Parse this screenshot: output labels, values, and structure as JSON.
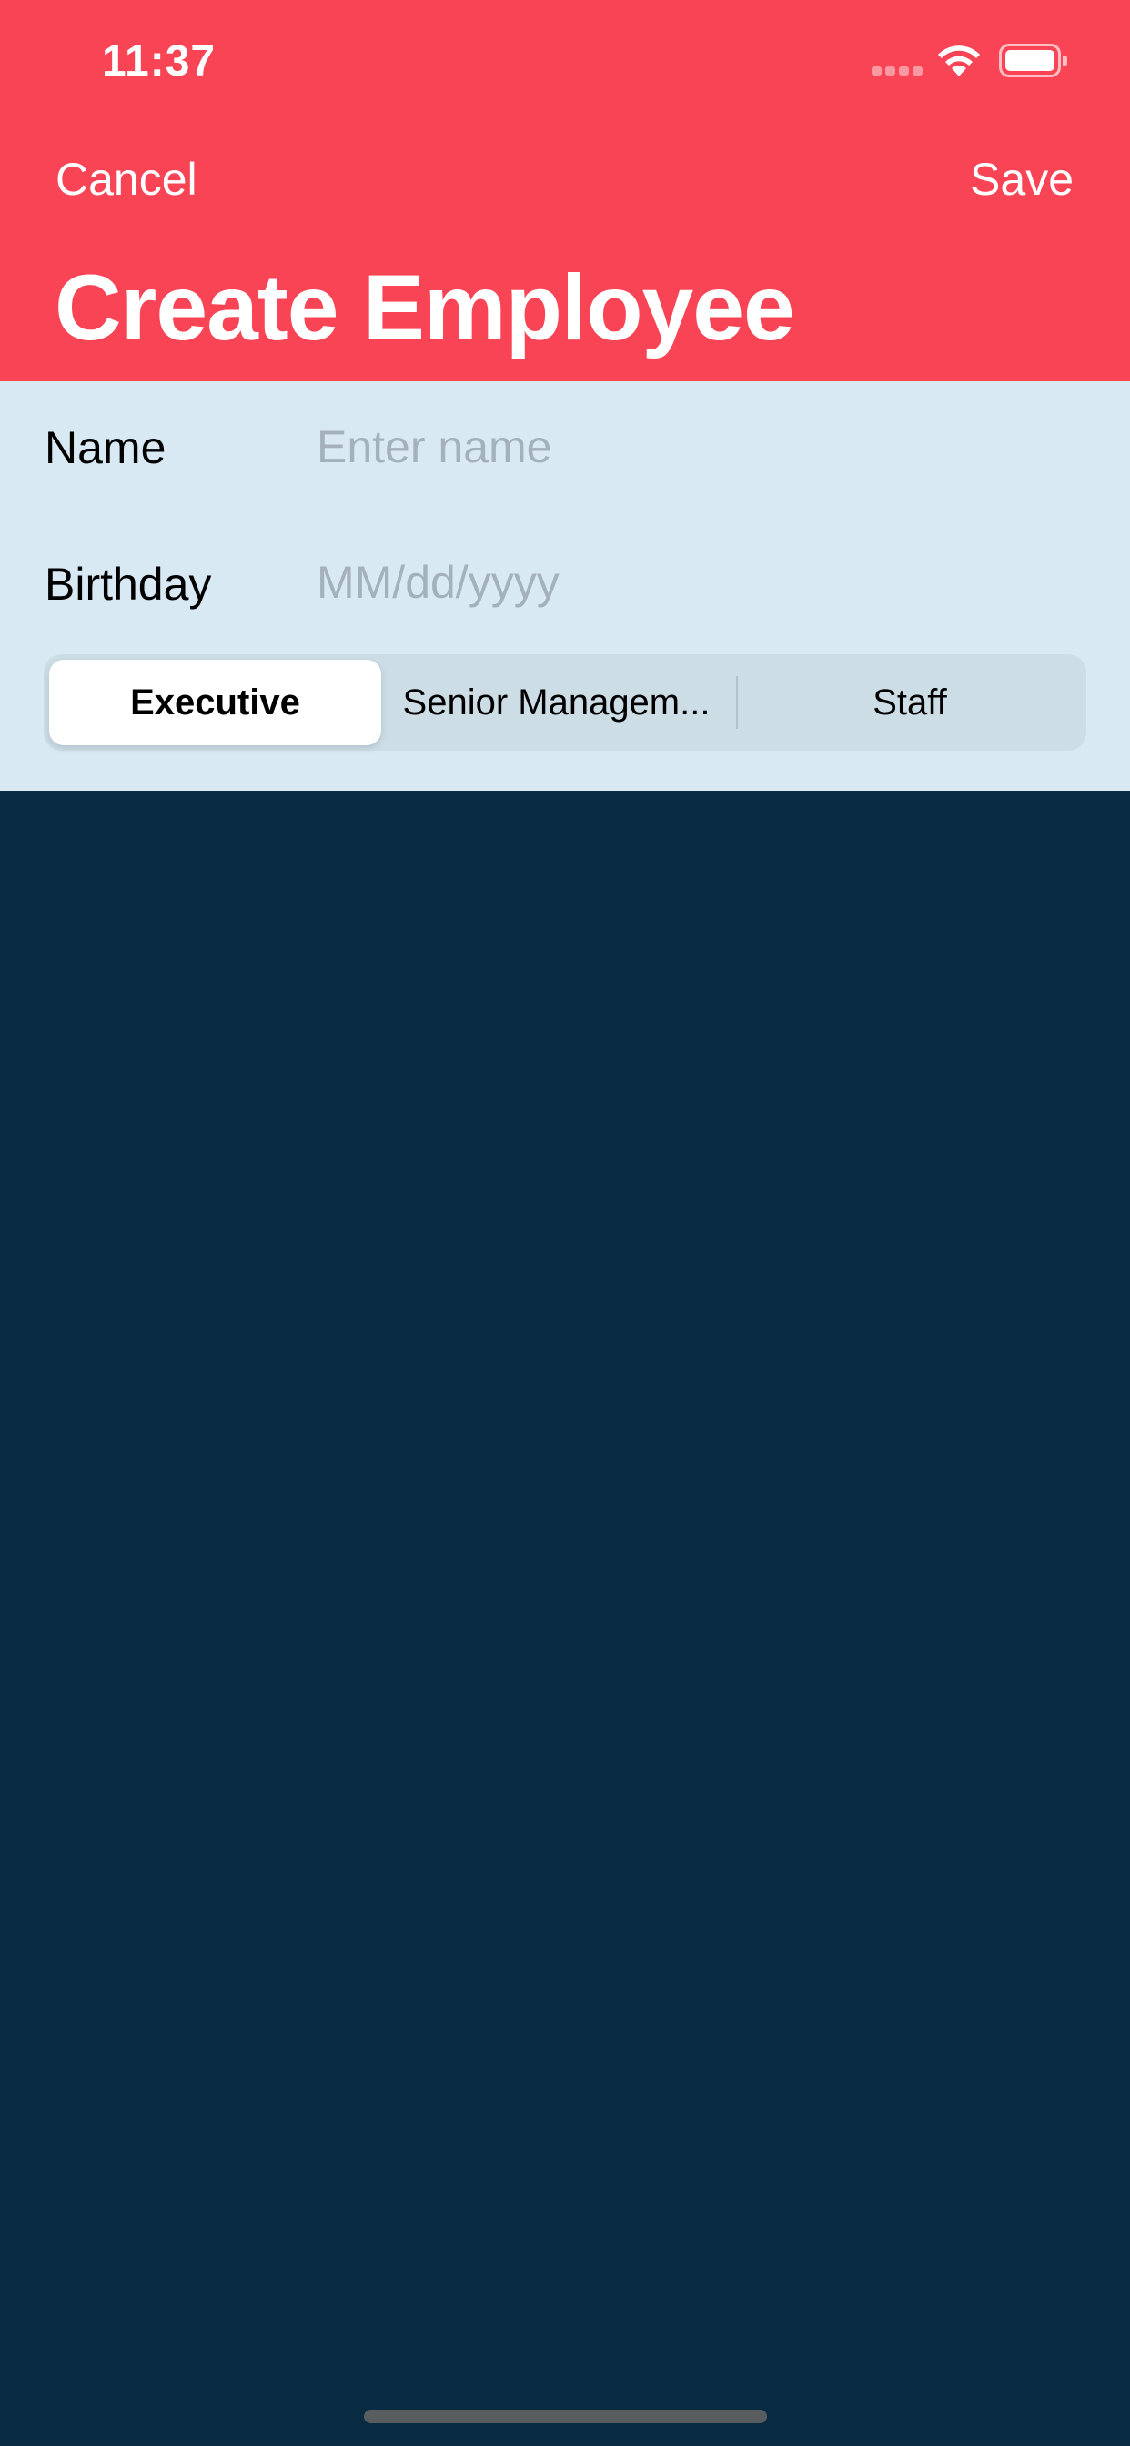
{
  "status_bar": {
    "time": "11:37"
  },
  "nav": {
    "cancel_label": "Cancel",
    "save_label": "Save",
    "title": "Create Employee"
  },
  "form": {
    "name_label": "Name",
    "name_placeholder": "Enter name",
    "name_value": "",
    "birthday_label": "Birthday",
    "birthday_placeholder": "MM/dd/yyyy",
    "birthday_value": ""
  },
  "segmented_control": {
    "options": [
      "Executive",
      "Senior Managem...",
      "Staff"
    ],
    "selected_index": 0
  },
  "colors": {
    "header": "#f94455",
    "form_background": "#d9e9f3",
    "page_background": "#0a2c42"
  }
}
